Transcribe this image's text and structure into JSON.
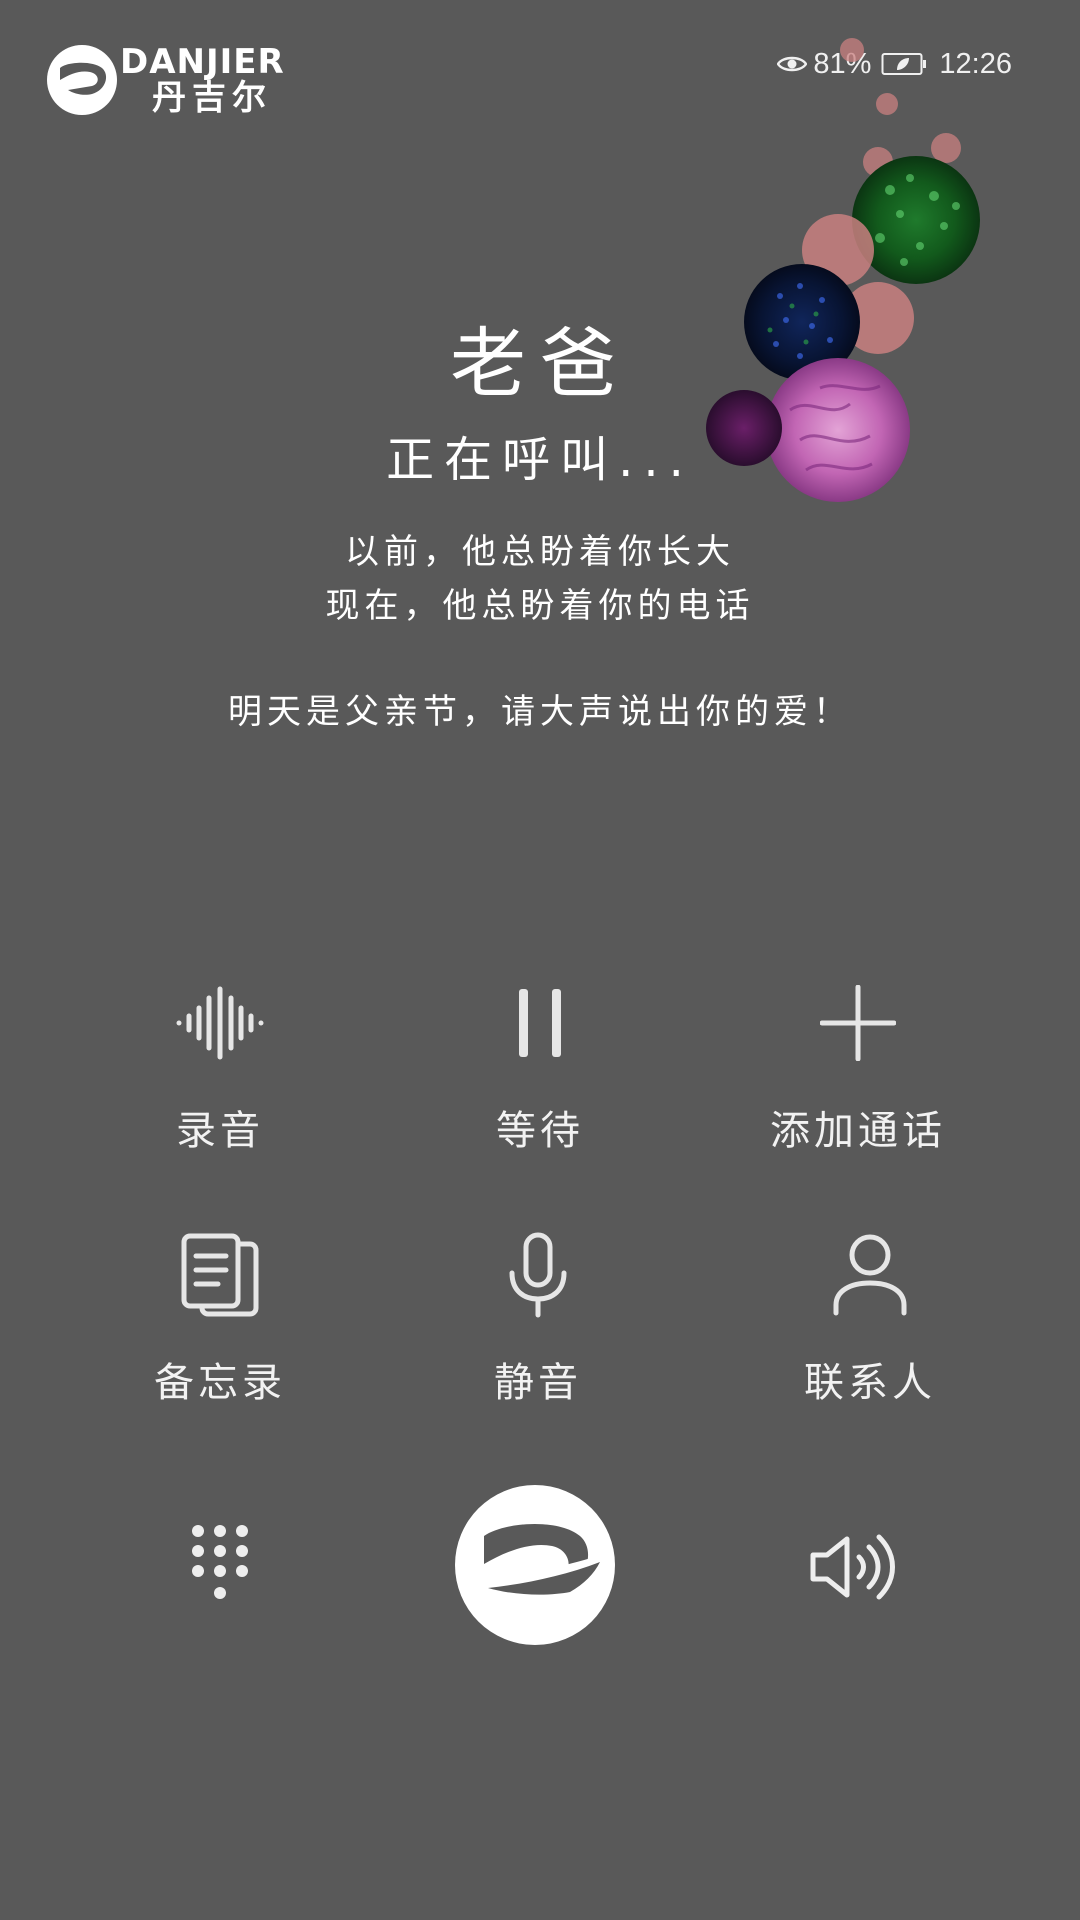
{
  "brand": {
    "name_en": "DANJIER",
    "name_cn": "丹吉尔"
  },
  "status_bar": {
    "eye_icon": "eye-icon",
    "battery_percent": "81%",
    "battery_icon": "battery-leaf-icon",
    "time": "12:26"
  },
  "call": {
    "caller_name": "老爸",
    "status": "正在呼叫..."
  },
  "message": {
    "line1": "以前，他总盼着你长大",
    "line2": "现在，他总盼着你的电话",
    "line3": "明天是父亲节，请大声说出你的爱！"
  },
  "actions": {
    "record": {
      "label": "录音",
      "icon": "waveform-icon"
    },
    "hold": {
      "label": "等待",
      "icon": "pause-icon"
    },
    "add_call": {
      "label": "添加通话",
      "icon": "plus-icon"
    },
    "notes": {
      "label": "备忘录",
      "icon": "notes-icon"
    },
    "mute": {
      "label": "静音",
      "icon": "microphone-icon"
    },
    "contacts": {
      "label": "联系人",
      "icon": "person-icon"
    }
  },
  "bottom": {
    "keypad_icon": "dialpad-icon",
    "end_call_icon": "danjier-logo-icon",
    "speaker_icon": "speaker-icon"
  },
  "colors": {
    "background": "#595959",
    "text": "#ffffff",
    "icon": "#ececec"
  }
}
